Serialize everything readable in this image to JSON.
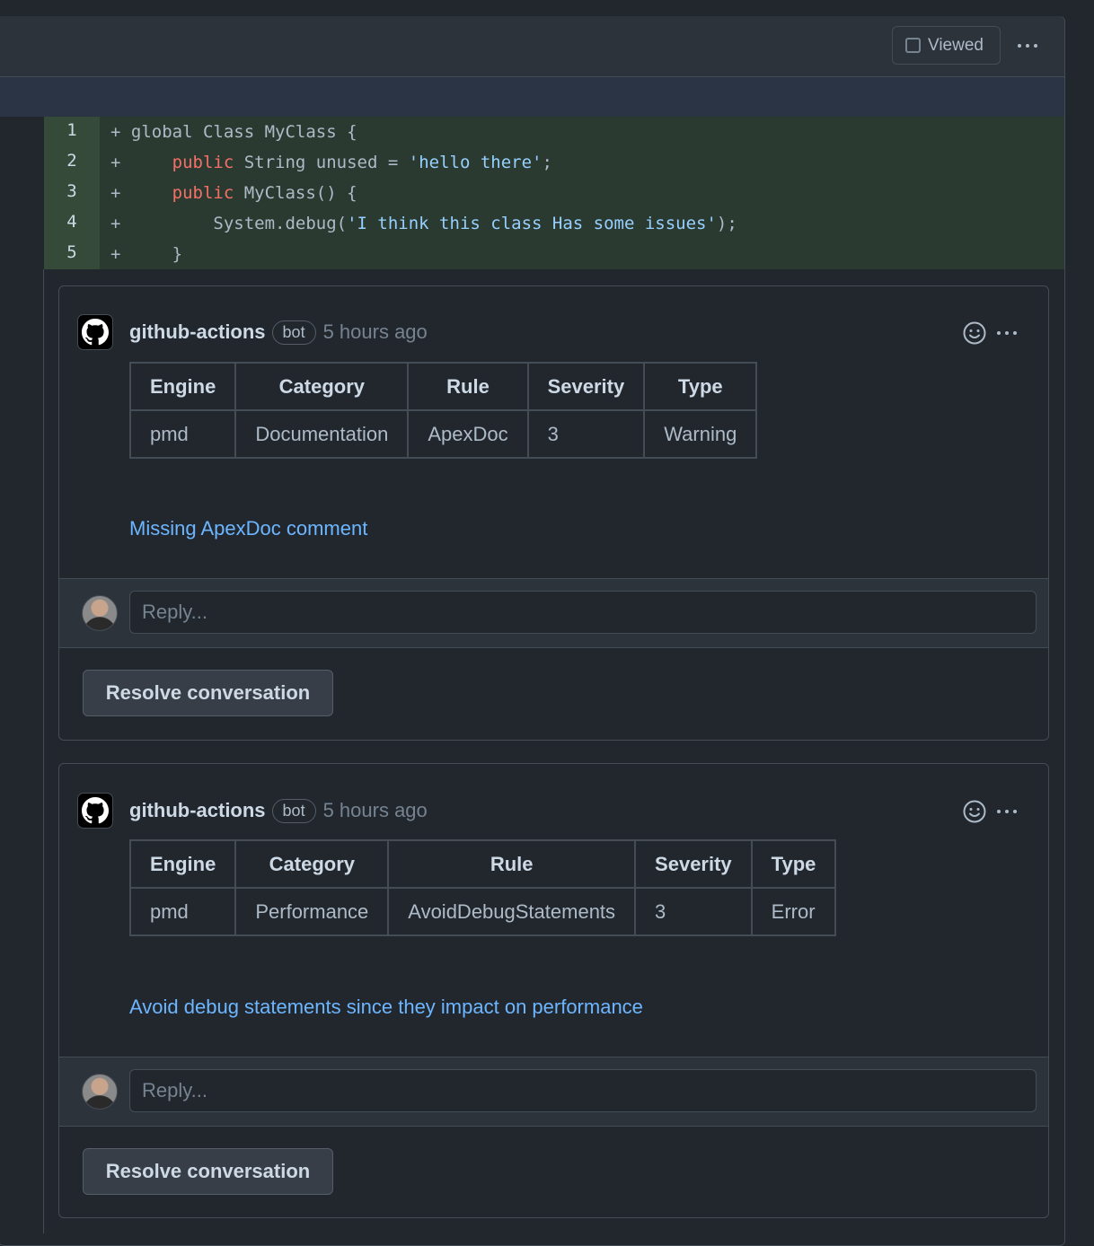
{
  "file_header": {
    "viewed_label": "Viewed"
  },
  "code": {
    "lines": [
      {
        "number": "1",
        "prefix": "+ ",
        "segments": [
          [
            "",
            "global Class MyClass {"
          ]
        ]
      },
      {
        "number": "2",
        "prefix": "+     ",
        "segments": [
          [
            "kw",
            "public"
          ],
          [
            "",
            " String unused = "
          ],
          [
            "str",
            "'hello there'"
          ],
          [
            "",
            ";"
          ]
        ]
      },
      {
        "number": "3",
        "prefix": "+     ",
        "segments": [
          [
            "kw",
            "public"
          ],
          [
            "",
            " MyClass() {"
          ]
        ]
      },
      {
        "number": "4",
        "prefix": "+         ",
        "segments": [
          [
            "",
            "System.debug("
          ],
          [
            "str",
            "'I think this class Has some issues'"
          ],
          [
            "",
            ");"
          ]
        ]
      },
      {
        "number": "5",
        "prefix": "+     ",
        "segments": [
          [
            "",
            "}"
          ]
        ]
      }
    ]
  },
  "threads": [
    {
      "author": "github-actions",
      "badge": "bot",
      "time": "5 hours ago",
      "table": {
        "headers": [
          "Engine",
          "Category",
          "Rule",
          "Severity",
          "Type"
        ],
        "row": [
          "pmd",
          "Documentation",
          "ApexDoc",
          "3",
          "Warning"
        ]
      },
      "message": "Missing ApexDoc comment",
      "reply_placeholder": "Reply...",
      "resolve_label": "Resolve conversation"
    },
    {
      "author": "github-actions",
      "badge": "bot",
      "time": "5 hours ago",
      "table": {
        "headers": [
          "Engine",
          "Category",
          "Rule",
          "Severity",
          "Type"
        ],
        "row": [
          "pmd",
          "Performance",
          "AvoidDebugStatements",
          "3",
          "Error"
        ]
      },
      "message": "Avoid debug statements since they impact on performance",
      "reply_placeholder": "Reply...",
      "resolve_label": "Resolve conversation"
    }
  ]
}
